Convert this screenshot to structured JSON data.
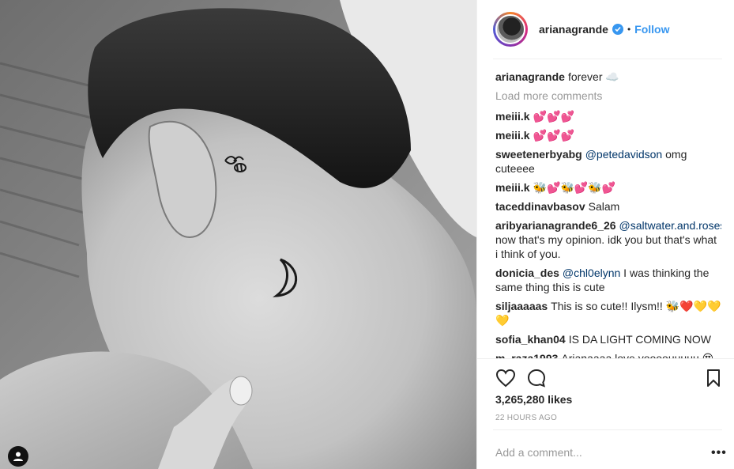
{
  "post": {
    "username": "arianagrande",
    "verified": true,
    "follow_label": "Follow",
    "separator": "•",
    "caption_user": "arianagrande",
    "caption_text": "forever ☁️",
    "load_more": "Load more comments",
    "comments": [
      {
        "user": "meiii.k",
        "parts": [
          {
            "t": "💕💕💕"
          }
        ]
      },
      {
        "user": "meiii.k",
        "parts": [
          {
            "t": "💕💕💕"
          }
        ]
      },
      {
        "user": "sweetenerbyabg",
        "parts": [
          {
            "t": "@petedavidson",
            "mention": true
          },
          {
            "t": " omg cuteeee"
          }
        ]
      },
      {
        "user": "meiii.k",
        "parts": [
          {
            "t": "🐝💕🐝💕🐝💕"
          }
        ]
      },
      {
        "user": "taceddinavbasov",
        "parts": [
          {
            "t": "Salam"
          }
        ]
      },
      {
        "user": "aribyarianagrande6_26",
        "parts": [
          {
            "t": "@saltwater.and.roses",
            "mention": true
          },
          {
            "t": " now that's my opinion. idk you but that's what i think of you."
          }
        ]
      },
      {
        "user": "donicia_des",
        "parts": [
          {
            "t": "@chl0elynn",
            "mention": true
          },
          {
            "t": " I was thinking the same thing this is cute"
          }
        ]
      },
      {
        "user": "siljaaaaas",
        "parts": [
          {
            "t": "This is so cute!! Ilysm!! 🐝❤️💛💛💛"
          }
        ]
      },
      {
        "user": "sofia_khan04",
        "parts": [
          {
            "t": "IS DA LIGHT COMING NOW"
          }
        ]
      },
      {
        "user": "m_raza1993",
        "parts": [
          {
            "t": "Arianaaaa love yoooouuuuu 😍"
          }
        ]
      }
    ],
    "likes": "3,265,280 likes",
    "time_ago": "22 HOURS AGO",
    "add_comment_placeholder": "Add a comment...",
    "more_label": "•••"
  },
  "icons": {
    "like": "heart-icon",
    "comment": "comment-icon",
    "save": "bookmark-icon",
    "user_tags": "user-tag-icon",
    "verified": "verified-badge-icon"
  },
  "colors": {
    "link": "#3897f0",
    "mention": "#003569",
    "muted": "#999999",
    "text": "#262626"
  }
}
